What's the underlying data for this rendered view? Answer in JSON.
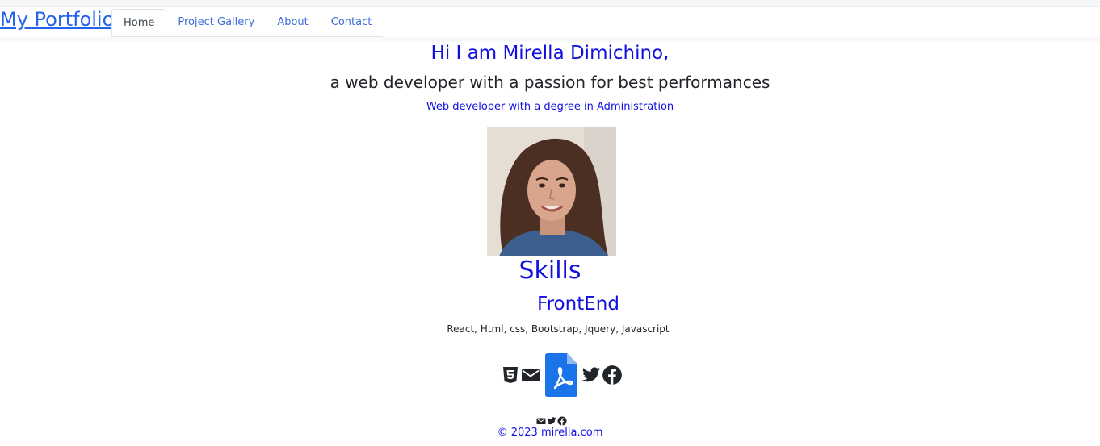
{
  "nav": {
    "brand": "My Portfolio",
    "tabs": [
      {
        "label": "Home",
        "active": true
      },
      {
        "label": "Project Gallery",
        "active": false
      },
      {
        "label": "About",
        "active": false
      },
      {
        "label": "Contact",
        "active": false
      }
    ]
  },
  "hero": {
    "greeting": "Hi I am Mirella Dimichino,",
    "tagline": "a web developer with a passion for best performances",
    "degree": "Web developer with a degree in Administration",
    "photo_icon": "profile-photo"
  },
  "skills": {
    "title": "Skills",
    "subtitle": "FrontEnd",
    "list": "React, Html, css, Bootstrap, Jquery, Javascript"
  },
  "icons": [
    "html5-icon",
    "mail-icon",
    "pdf-file-icon",
    "twitter-icon",
    "facebook-icon"
  ],
  "footer": {
    "icons": [
      "mail-icon",
      "twitter-icon",
      "facebook-icon"
    ],
    "copyright": "© 2023 mirella.com"
  },
  "colors": {
    "accent": "#1010e0",
    "link": "#2563eb",
    "pdf_blue": "#1a73e8",
    "text": "#212529"
  }
}
